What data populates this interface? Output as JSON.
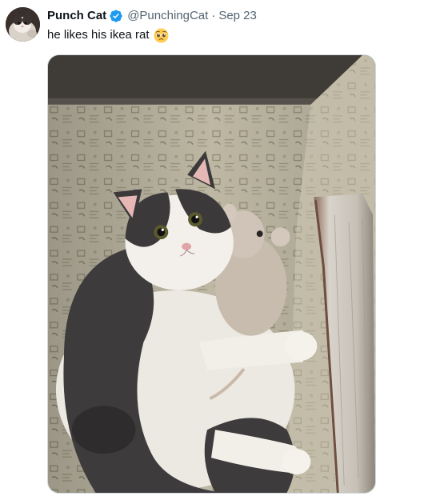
{
  "tweet": {
    "display_name": "Punch Cat",
    "verified": true,
    "handle": "@PunchingCat",
    "separator": "·",
    "date": "Sep 23",
    "text": "he likes his ikea rat",
    "emoji": "pleading-face-emoji"
  },
  "media": {
    "type": "photo",
    "subject": "black and white cat hugging plush ikea rat on patterned armchair"
  },
  "colors": {
    "text_primary": "#0f1419",
    "text_secondary": "#536471",
    "verified_blue": "#1d9bf0",
    "media_border": "#cfd9de"
  }
}
